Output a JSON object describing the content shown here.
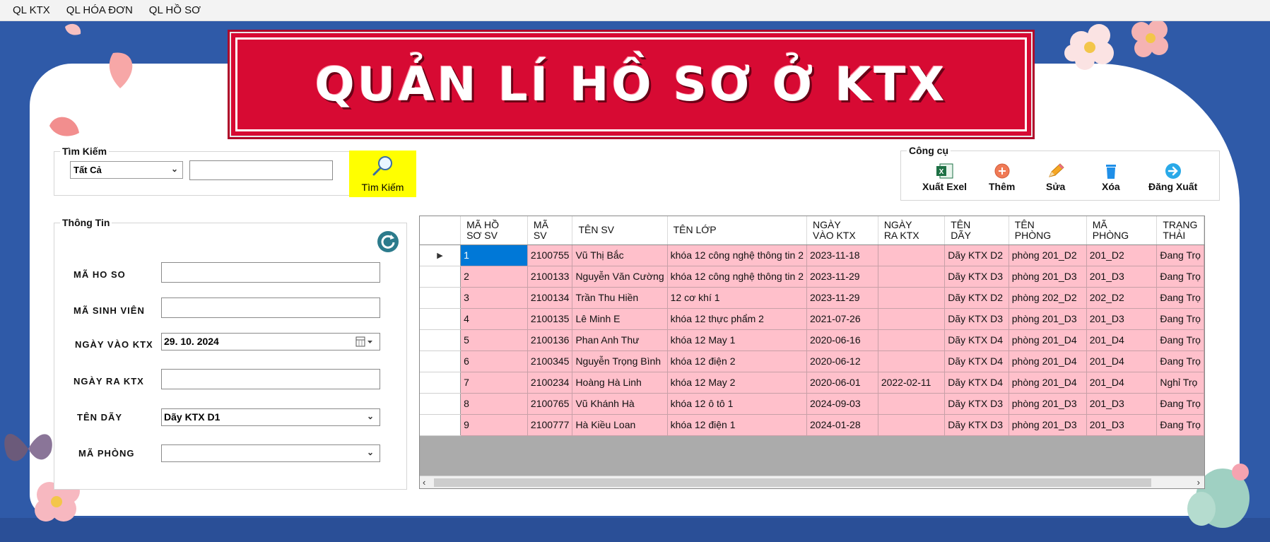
{
  "menu": [
    "QL KTX",
    "QL HÓA ĐƠN",
    "QL HỒ SƠ"
  ],
  "banner": {
    "title": "QUẢN LÍ HỒ SƠ Ở KTX"
  },
  "search": {
    "group_title": "Tìm Kiếm",
    "filter_value": "Tất Cả",
    "query": "",
    "button_label": "Tìm Kiếm"
  },
  "tools": {
    "group_title": "Công cụ",
    "export_label": "Xuất Exel",
    "add_label": "Thêm",
    "edit_label": "Sửa",
    "delete_label": "Xóa",
    "logout_label": "Đăng Xuất"
  },
  "info": {
    "group_title": "Thông Tin",
    "ma_ho_so_label": "MÃ HO SO",
    "ma_ho_so_value": "",
    "ma_sinh_vien_label": "MÃ SINH VIÊN",
    "ma_sinh_vien_value": "",
    "ngay_vao_label": "NGÀY VÀO KTX",
    "ngay_vao_value": "29. 10. 2024",
    "ngay_ra_label": "NGÀY RA KTX",
    "ngay_ra_value": "",
    "ten_day_label": "TÊN DÃY",
    "ten_day_value": "Dãy KTX D1",
    "ma_phong_label": "MÃ PHÒNG",
    "ma_phong_value": ""
  },
  "grid": {
    "columns": [
      [
        "MÃ HỒ",
        "SƠ SV"
      ],
      [
        "MÃ",
        "SV"
      ],
      [
        "TÊN SV",
        ""
      ],
      [
        "TÊN LỚP",
        ""
      ],
      [
        "NGÀY",
        "VÀO KTX"
      ],
      [
        "NGÀY",
        "RA KTX"
      ],
      [
        "TÊN",
        "DÃY"
      ],
      [
        "TÊN",
        "PHÒNG"
      ],
      [
        "MÃ",
        "PHÒNG"
      ],
      [
        "TRẠNG",
        "THÁI"
      ]
    ],
    "rows": [
      [
        "1",
        "2100755",
        "Vũ Thị Bắc",
        "khóa 12 công nghệ thông tin 2",
        "2023-11-18",
        "",
        "Dãy KTX D2",
        "phòng 201_D2",
        "201_D2",
        "Đang Trọ"
      ],
      [
        "2",
        "2100133",
        "Nguyễn Văn Cường",
        "khóa 12 công nghệ thông tin 2",
        "2023-11-29",
        "",
        "Dãy KTX D3",
        "phòng 201_D3",
        "201_D3",
        "Đang Trọ"
      ],
      [
        "3",
        "2100134",
        "Trần Thu Hiền",
        "12 cơ khí 1",
        "2023-11-29",
        "",
        "Dãy KTX D2",
        "phòng 202_D2",
        "202_D2",
        "Đang Trọ"
      ],
      [
        "4",
        "2100135",
        "Lê Minh E",
        "khóa 12 thực phẩm 2",
        "2021-07-26",
        "",
        "Dãy KTX D3",
        "phòng 201_D3",
        "201_D3",
        "Đang Trọ"
      ],
      [
        "5",
        "2100136",
        "Phan Anh Thư",
        "khóa 12 May 1",
        "2020-06-16",
        "",
        "Dãy KTX D4",
        "phòng 201_D4",
        "201_D4",
        "Đang Trọ"
      ],
      [
        "6",
        "2100345",
        "Nguyễn Trọng Bình",
        "khóa 12 điện 2",
        "2020-06-12",
        "",
        "Dãy KTX D4",
        "phòng 201_D4",
        "201_D4",
        "Đang Trọ"
      ],
      [
        "7",
        "2100234",
        "Hoàng Hà Linh",
        "khóa 12 May 2",
        "2020-06-01",
        "2022-02-11",
        "Dãy KTX D4",
        "phòng 201_D4",
        "201_D4",
        "Nghỉ Trọ"
      ],
      [
        "8",
        "2100765",
        "Vũ Khánh Hà",
        "khóa 12 ô tô 1",
        "2024-09-03",
        "",
        "Dãy KTX D3",
        "phòng 201_D3",
        "201_D3",
        "Đang Trọ"
      ],
      [
        "9",
        "2100777",
        "Hà Kiều Loan",
        "khóa 12 điện 1",
        "2024-01-28",
        "",
        "Dãy KTX D3",
        "phòng 201_D3",
        "201_D3",
        "Đang Trọ"
      ]
    ]
  },
  "colors": {
    "banner_red": "#d70a33",
    "background_blue": "#2f5aa8",
    "row_pink": "#ffc0cb",
    "selection_blue": "#0078d7",
    "search_yellow": "#ffff00"
  }
}
